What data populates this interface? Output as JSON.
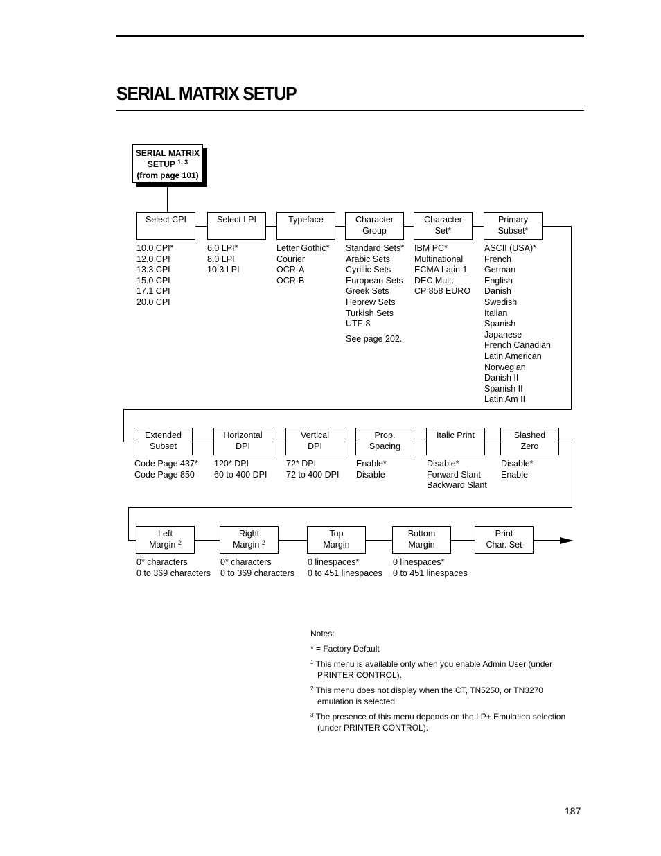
{
  "page": {
    "title": "SERIAL MATRIX SETUP",
    "page_number": "187"
  },
  "root": {
    "line1": "SERIAL MATRIX",
    "line2": "SETUP",
    "line2_sup": "1, 3",
    "line3": "(from page 101)"
  },
  "row1": [
    {
      "label1": "Select CPI",
      "label2": "",
      "sup": "",
      "options": [
        "10.0 CPI*",
        "12.0 CPI",
        "13.3 CPI",
        "15.0 CPI",
        "17.1 CPI",
        "20.0 CPI"
      ]
    },
    {
      "label1": "Select LPI",
      "label2": "",
      "sup": "",
      "options": [
        "6.0 LPI*",
        "8.0 LPI",
        "10.3 LPI"
      ]
    },
    {
      "label1": "Typeface",
      "label2": "",
      "sup": "",
      "options": [
        "Letter Gothic*",
        "Courier",
        "OCR-A",
        "OCR-B"
      ]
    },
    {
      "label1": "Character",
      "label2": "Group",
      "sup": "",
      "options": [
        "Standard Sets*",
        "Arabic Sets",
        "Cyrillic Sets",
        "European Sets",
        "Greek Sets",
        "Hebrew Sets",
        "Turkish Sets",
        "UTF-8"
      ],
      "extra": "See page 202."
    },
    {
      "label1": "Character",
      "label2": "Set*",
      "sup": "",
      "options": [
        "IBM PC*",
        "Multinational",
        "ECMA Latin 1",
        "DEC Mult.",
        "CP 858 EURO"
      ]
    },
    {
      "label1": "Primary",
      "label2": "Subset*",
      "sup": "",
      "options": [
        "ASCII (USA)*",
        "French",
        "German",
        "English",
        "Danish",
        "Swedish",
        "Italian",
        "Spanish",
        "Japanese",
        "French Canadian",
        "Latin American",
        "Norwegian",
        "Danish II",
        "Spanish II",
        "Latin Am II"
      ]
    }
  ],
  "row2": [
    {
      "label1": "Extended",
      "label2": "Subset",
      "options": [
        "Code Page 437*",
        "Code Page 850"
      ]
    },
    {
      "label1": "Horizontal",
      "label2": "DPI",
      "options": [
        "120* DPI",
        "60 to 400 DPI"
      ]
    },
    {
      "label1": "Vertical",
      "label2": "DPI",
      "options": [
        "72* DPI",
        "72 to 400 DPI"
      ]
    },
    {
      "label1": "Prop.",
      "label2": "Spacing",
      "options": [
        "Enable*",
        "Disable"
      ]
    },
    {
      "label1": "Italic Print",
      "label2": "",
      "options": [
        "Disable*",
        "Forward Slant",
        "Backward Slant"
      ]
    },
    {
      "label1": "Slashed",
      "label2": "Zero",
      "options": [
        "Disable*",
        "Enable"
      ]
    }
  ],
  "row3": [
    {
      "label1": "Left",
      "label2": "Margin",
      "sup": "2",
      "options": [
        "0* characters",
        "0 to 369 characters"
      ]
    },
    {
      "label1": "Right",
      "label2": "Margin",
      "sup": "2",
      "options": [
        "0* characters",
        "0 to 369 characters"
      ]
    },
    {
      "label1": "Top",
      "label2": "Margin",
      "sup": "",
      "options": [
        "0 linespaces*",
        "0 to 451 linespaces"
      ]
    },
    {
      "label1": "Bottom",
      "label2": "Margin",
      "sup": "",
      "options": [
        "0 linespaces*",
        "0 to 451 linespaces"
      ]
    },
    {
      "label1": "Print",
      "label2": "Char. Set",
      "sup": "",
      "options": []
    }
  ],
  "notes": {
    "heading": "Notes:",
    "default": "* = Factory Default",
    "footnotes": [
      {
        "num": "1",
        "text": "This menu is available only when you enable Admin User (under PRINTER CONTROL)."
      },
      {
        "num": "2",
        "text": "This menu does not display when the CT, TN5250, or TN3270 emulation is selected."
      },
      {
        "num": "3",
        "text": "The presence of this menu depends on the LP+ Emulation selection (under PRINTER CONTROL)."
      }
    ]
  }
}
